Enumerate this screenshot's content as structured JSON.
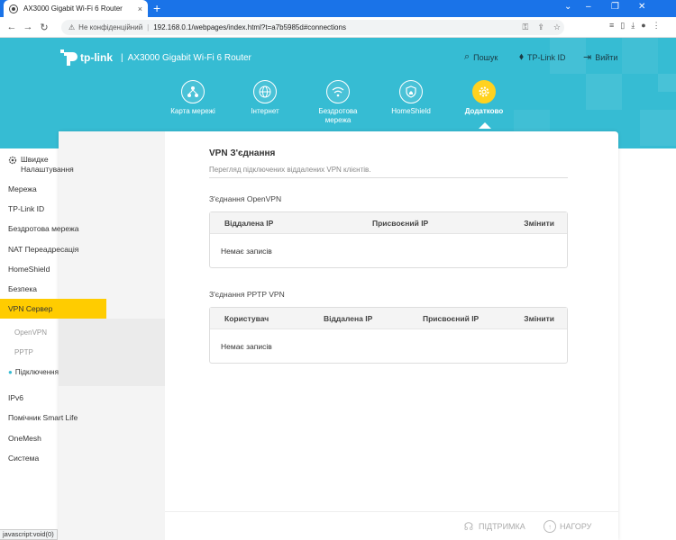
{
  "browser": {
    "tab_title": "AX3000 Gigabit Wi-Fi 6 Router",
    "tab_close": "×",
    "new_tab": "+",
    "not_secure": "Не конфіденційний",
    "url": "192.168.0.1/webpages/index.html?t=a7b5985d#connections",
    "status_url": "javascript:void(0)"
  },
  "header": {
    "logo": "tp-link",
    "separator": "|",
    "model": "AX3000 Gigabit Wi-Fi 6 Router",
    "search_label": "Пошук",
    "tplink_id_label": "TP-Link ID",
    "logout_label": "Вийти",
    "nav": [
      {
        "label": "Карта мережі",
        "icon": "network-map-icon"
      },
      {
        "label": "Інтернет",
        "icon": "globe-icon"
      },
      {
        "label": "Бездротова мережа",
        "icon": "wifi-icon"
      },
      {
        "label": "HomeShield",
        "icon": "homeshield-icon"
      },
      {
        "label": "Додатково",
        "icon": "gear-icon",
        "active": true
      }
    ]
  },
  "sidebar": {
    "quick_setup": "Швидке Налаштування",
    "items": [
      {
        "label": "Мережа"
      },
      {
        "label": "TP-Link ID"
      },
      {
        "label": "Бездротова мережа"
      },
      {
        "label": "NAT Переадресація"
      },
      {
        "label": "HomeShield"
      },
      {
        "label": "Безпека"
      },
      {
        "label": "VPN Сервер",
        "active": true
      },
      {
        "label": "IPv6"
      },
      {
        "label": "Помічник Smart Life"
      },
      {
        "label": "OneMesh"
      },
      {
        "label": "Система"
      }
    ],
    "vpn_sub": [
      {
        "label": "OpenVPN"
      },
      {
        "label": "PPTP"
      },
      {
        "label": "Підключення",
        "current": true
      }
    ]
  },
  "content": {
    "title": "VPN З'єднання",
    "subtitle": "Перегляд підключених віддалених VPN клієнтів.",
    "openvpn": {
      "title": "З'єднання OpenVPN",
      "columns": [
        "Віддалена IP",
        "Присвоєний IP",
        "Змінити"
      ],
      "empty": "Немає записів"
    },
    "pptp": {
      "title": "З'єднання PPTP VPN",
      "columns": [
        "Користувач",
        "Віддалена IP",
        "Присвоєний IP",
        "Змінити"
      ],
      "empty": "Немає записів"
    }
  },
  "footer": {
    "support": "ПІДТРИМКА",
    "top": "НАГОРУ"
  },
  "colors": {
    "header_bg": "#36bcd3",
    "accent_yellow": "#ffcc00",
    "browser_blue": "#1a73e8"
  }
}
